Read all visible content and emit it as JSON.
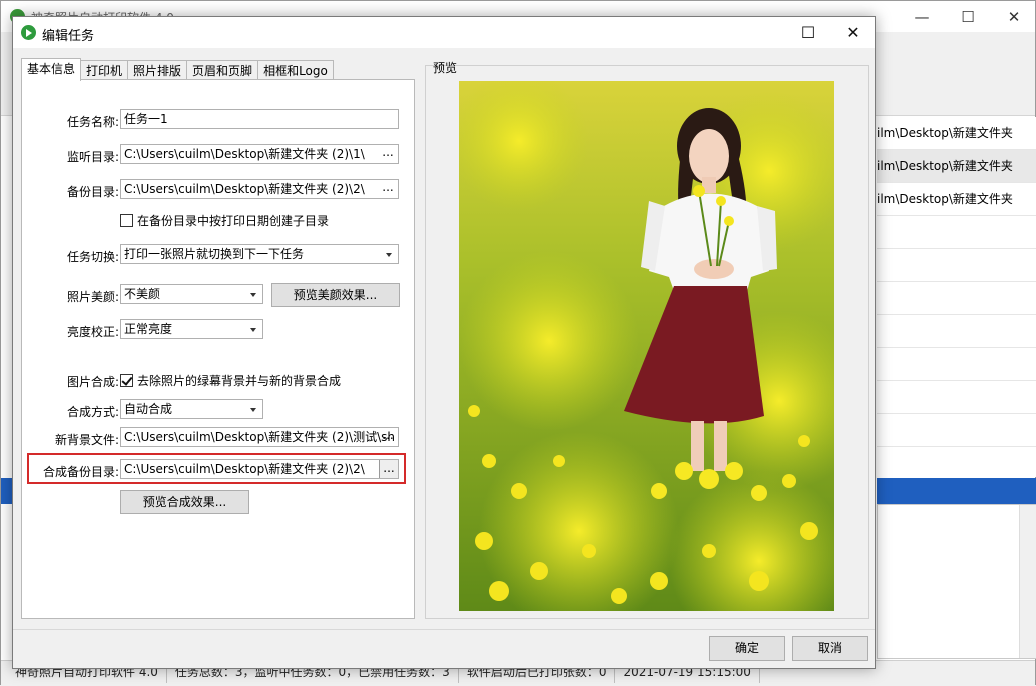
{
  "background_app": {
    "title": "神奇照片自动打印软件 4.0",
    "list_rows": [
      "ilm\\Desktop\\新建文件夹",
      "ilm\\Desktop\\新建文件夹",
      "ilm\\Desktop\\新建文件夹"
    ],
    "status_bar": [
      "神奇照片自动打印软件 4.0",
      "任务总数：3，监听中任务数：0，已禁用任务数：3",
      "软件启动后已打印张数：0",
      "2021-07-19 15:15:00"
    ]
  },
  "dialog": {
    "title": "编辑任务",
    "tabs": [
      "基本信息",
      "打印机",
      "照片排版",
      "页眉和页脚",
      "相框和Logo"
    ],
    "active_tab": 0,
    "fields": {
      "task_name_label": "任务名称:",
      "task_name_value": "任务一1",
      "watch_dir_label": "监听目录:",
      "watch_dir_value": "C:\\Users\\cuilm\\Desktop\\新建文件夹 (2)\\1\\",
      "backup_dir_label": "备份目录:",
      "backup_dir_value": "C:\\Users\\cuilm\\Desktop\\新建文件夹 (2)\\2\\",
      "date_subdir_label": "在备份目录中按打印日期创建子目录",
      "task_switch_label": "任务切换:",
      "task_switch_value": "打印一张照片就切换到下一下任务",
      "beauty_label": "照片美颜:",
      "beauty_value": "不美颜",
      "beauty_preview_button": "预览美颜效果...",
      "brightness_label": "亮度校正:",
      "brightness_value": "正常亮度",
      "composite_label": "图片合成:",
      "composite_check_label": "去除照片的绿幕背景并与新的背景合成",
      "composite_mode_label": "合成方式:",
      "composite_mode_value": "自动合成",
      "new_bg_label": "新背景文件:",
      "new_bg_value": "C:\\Users\\cuilm\\Desktop\\新建文件夹 (2)\\测试\\sh",
      "composite_backup_label": "合成备份目录:",
      "composite_backup_value": "C:\\Users\\cuilm\\Desktop\\新建文件夹 (2)\\2\\",
      "composite_preview_button": "预览合成效果...",
      "browse_label": "..."
    },
    "preview_label": "预览",
    "ok_button": "确定",
    "cancel_button": "取消"
  }
}
